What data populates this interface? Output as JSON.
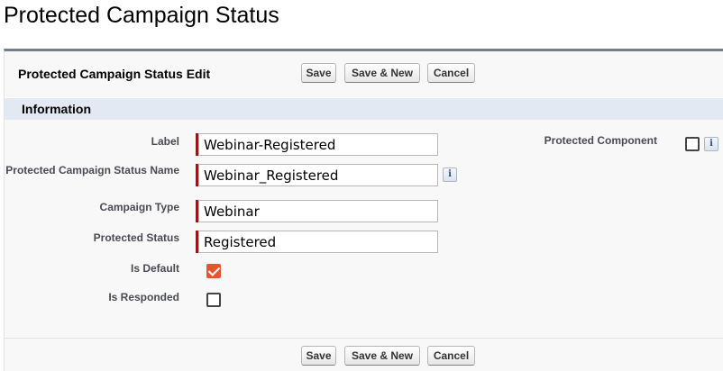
{
  "page": {
    "title": "Protected Campaign Status"
  },
  "panel": {
    "title": "Protected Campaign Status Edit",
    "buttons": {
      "save": "Save",
      "save_new": "Save & New",
      "cancel": "Cancel"
    }
  },
  "section": {
    "title": "Information"
  },
  "fields": {
    "label": {
      "label": "Label",
      "value": "Webinar-Registered"
    },
    "name": {
      "label": "Protected Campaign Status Name",
      "value": "Webinar_Registered"
    },
    "campaign_type": {
      "label": "Campaign Type",
      "value": "Webinar"
    },
    "protected_status": {
      "label": "Protected Status",
      "value": "Registered"
    },
    "is_default": {
      "label": "Is Default",
      "checked": true
    },
    "is_responded": {
      "label": "Is Responded",
      "checked": false
    },
    "protected_component": {
      "label": "Protected Component",
      "checked": false
    }
  },
  "icons": {
    "info_glyph": "i"
  },
  "colors": {
    "required": "#cc0000",
    "checkbox_checked": "#e4572e",
    "section_header": "#e3e9f2",
    "panel_border": "#747e8b"
  }
}
